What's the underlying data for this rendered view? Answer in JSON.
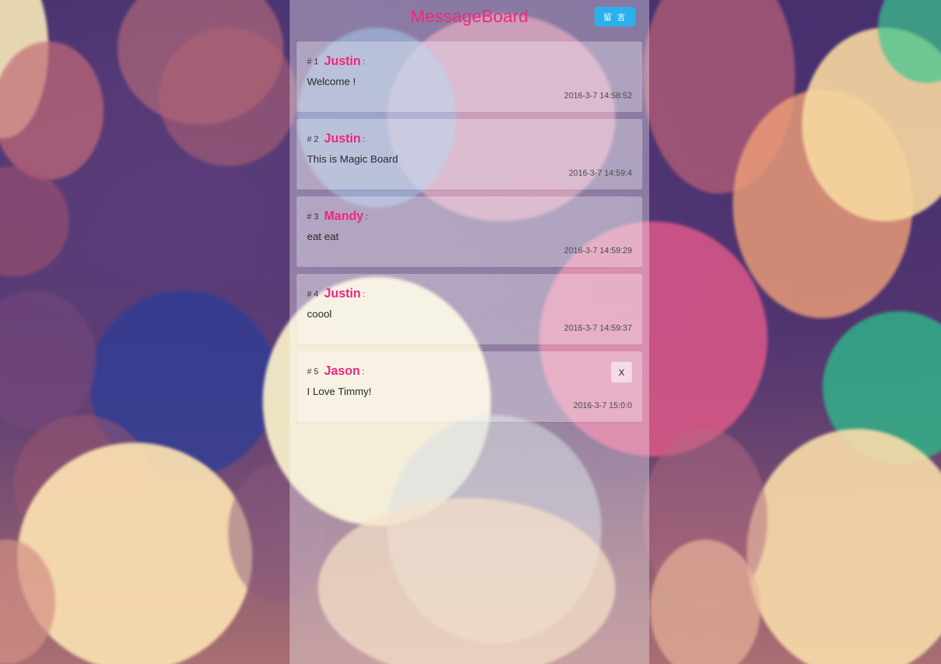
{
  "header": {
    "title": "MessageBoard",
    "post_button_label": "留 言"
  },
  "messages": [
    {
      "number": "# 1",
      "author": "Justin",
      "colon": ":",
      "text": "Welcome !",
      "time": "2016-3-7 14:58:52"
    },
    {
      "number": "# 2",
      "author": "Justin",
      "colon": ":",
      "text": "This is Magic Board",
      "time": "2016-3-7 14:59:4"
    },
    {
      "number": "# 3",
      "author": "Mandy",
      "colon": ":",
      "text": "eat eat",
      "time": "2016-3-7 14:59:29"
    },
    {
      "number": "# 4",
      "author": "Justin",
      "colon": ":",
      "text": "coool",
      "time": "2016-3-7 14:59:37"
    },
    {
      "number": "# 5",
      "author": "Jason",
      "colon": ":",
      "text": "I Love Timmy!",
      "time": "2016-3-7 15:0:0",
      "delete_label": "X"
    }
  ],
  "colors": {
    "accent": "#f0287a",
    "button": "#2bb0ee"
  },
  "background": "bokeh-lights-image"
}
